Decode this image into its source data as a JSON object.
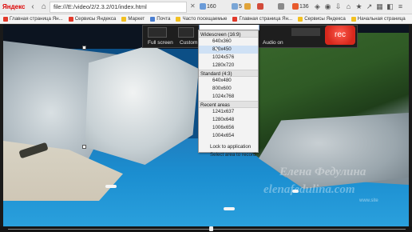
{
  "browser": {
    "logo": "Яндекс",
    "url": "file:///E:/video/2/2.3.2/01/index.html",
    "stats": [
      {
        "value": "160",
        "color": "#6a9bd8"
      },
      {
        "value": "5",
        "color": "#7aa6d6"
      },
      {
        "value": "",
        "color": "#e0a43a"
      },
      {
        "value": "",
        "color": "#d24a3a"
      },
      {
        "value": "",
        "color": "#8a8a8a"
      },
      {
        "value": "136",
        "color": "#e85a2c"
      }
    ],
    "bookmarks": [
      {
        "label": "Главная страница Ян...",
        "color": "#e23a2b"
      },
      {
        "label": "Сервисы Яндекса",
        "color": "#e23a2b"
      },
      {
        "label": "Маркет",
        "color": "#f2c021"
      },
      {
        "label": "Почта",
        "color": "#4b7fd1"
      },
      {
        "label": "Часто посещаемые",
        "color": "#f2c021"
      },
      {
        "label": "Главная страница Ян...",
        "color": "#e23a2b"
      },
      {
        "label": "Сервисы Яндекса",
        "color": "#f2c021"
      },
      {
        "label": "Начальная страница",
        "color": "#f2c021"
      }
    ]
  },
  "recorder": {
    "full_screen_label": "Full screen",
    "custom_label": "Custom",
    "audio_label": "Audio on",
    "rec_label": "rec"
  },
  "dropdown": {
    "sections": [
      {
        "header": "Widescreen (16:9)",
        "items": [
          "640x360",
          "880x450",
          "1024x576",
          "1280x720"
        ]
      },
      {
        "header": "Standard (4:3)",
        "items": [
          "640x480",
          "800x600",
          "1024x768"
        ]
      },
      {
        "header": "Recent areas",
        "items": [
          "1241x637",
          "1280x648",
          "1006x656",
          "1004x654"
        ]
      }
    ],
    "footer": [
      "Lock to application",
      "Select area to record"
    ],
    "hover_item": "880x450"
  },
  "watermark": {
    "line1": "Елена Федулина",
    "line2": "elenafedulina.com",
    "line3": "www.site"
  },
  "timeline": {
    "progress": 0.51
  }
}
